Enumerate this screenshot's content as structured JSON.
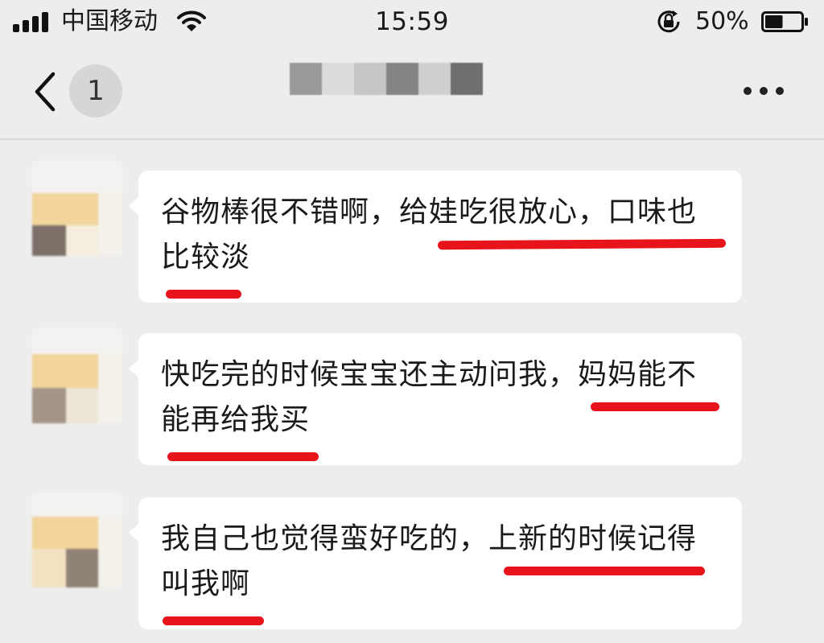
{
  "status_bar": {
    "carrier": "中国移动",
    "time": "15:59",
    "battery_percent": "50%",
    "battery_level": 0.5,
    "icons": [
      "signal-icon",
      "wifi-icon",
      "rotation-lock-icon",
      "battery-icon"
    ]
  },
  "nav": {
    "back_icon": "chevron-left-icon",
    "unread_count": "1",
    "title_obscured": true,
    "more_icon": "more-dots-icon"
  },
  "messages": [
    {
      "line1": "谷物棒很不错啊，给娃吃很放心，口味也",
      "line2": "比较淡"
    },
    {
      "line1": "快吃完的时候宝宝还主动问我，妈妈能不",
      "line2": "能再给我买"
    },
    {
      "line1": "我自己也觉得蛮好吃的，上新的时候记得",
      "line2": "叫我啊"
    }
  ],
  "colors": {
    "background": "#ededed",
    "bubble": "#ffffff",
    "highlight_underline": "#e8141b",
    "badge": "#d6d6d6"
  }
}
